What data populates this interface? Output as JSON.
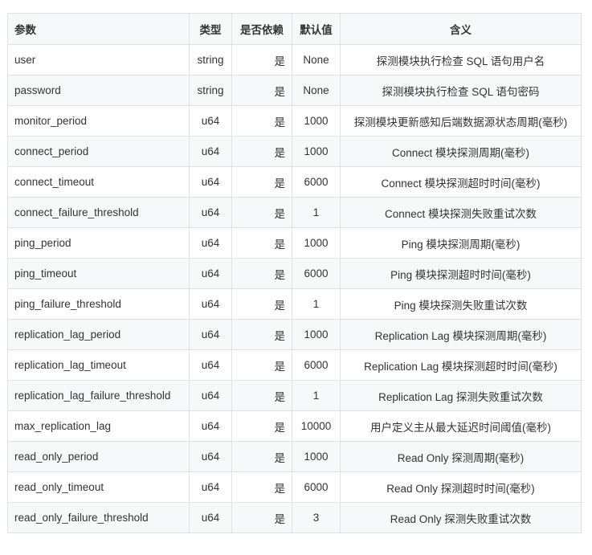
{
  "table": {
    "headers": {
      "param": "参数",
      "type": "类型",
      "required": "是否依赖",
      "default": "默认值",
      "desc": "含义"
    },
    "rows": [
      {
        "param": "user",
        "type": "string",
        "required": "是",
        "default": "None",
        "desc": "探测模块执行检查 SQL 语句用户名"
      },
      {
        "param": "password",
        "type": "string",
        "required": "是",
        "default": "None",
        "desc": "探测模块执行检查 SQL 语句密码"
      },
      {
        "param": "monitor_period",
        "type": "u64",
        "required": "是",
        "default": "1000",
        "desc": "探测模块更新感知后端数据源状态周期(毫秒)"
      },
      {
        "param": "connect_period",
        "type": "u64",
        "required": "是",
        "default": "1000",
        "desc": "Connect 模块探测周期(毫秒)"
      },
      {
        "param": "connect_timeout",
        "type": "u64",
        "required": "是",
        "default": "6000",
        "desc": "Connect 模块探测超时时间(毫秒)"
      },
      {
        "param": "connect_failure_threshold",
        "type": "u64",
        "required": "是",
        "default": "1",
        "desc": "Connect 模块探测失败重试次数"
      },
      {
        "param": "ping_period",
        "type": "u64",
        "required": "是",
        "default": "1000",
        "desc": "Ping 模块探测周期(毫秒)"
      },
      {
        "param": "ping_timeout",
        "type": "u64",
        "required": "是",
        "default": "6000",
        "desc": "Ping 模块探测超时时间(毫秒)"
      },
      {
        "param": "ping_failure_threshold",
        "type": "u64",
        "required": "是",
        "default": "1",
        "desc": "Ping 模块探测失败重试次数"
      },
      {
        "param": "replication_lag_period",
        "type": "u64",
        "required": "是",
        "default": "1000",
        "desc": "Replication Lag 模块探测周期(毫秒)"
      },
      {
        "param": "replication_lag_timeout",
        "type": "u64",
        "required": "是",
        "default": "6000",
        "desc": "Replication Lag 模块探测超时时间(毫秒)"
      },
      {
        "param": "replication_lag_failure_threshold",
        "type": "u64",
        "required": "是",
        "default": "1",
        "desc": "Replication Lag 探测失败重试次数"
      },
      {
        "param": "max_replication_lag",
        "type": "u64",
        "required": "是",
        "default": "10000",
        "desc": "用户定义主从最大延迟时间阈值(毫秒)"
      },
      {
        "param": "read_only_period",
        "type": "u64",
        "required": "是",
        "default": "1000",
        "desc": "Read Only 探测周期(毫秒)"
      },
      {
        "param": "read_only_timeout",
        "type": "u64",
        "required": "是",
        "default": "6000",
        "desc": "Read Only 探测超时时间(毫秒)"
      },
      {
        "param": "read_only_failure_threshold",
        "type": "u64",
        "required": "是",
        "default": "3",
        "desc": "Read Only 探测失败重试次数"
      }
    ]
  }
}
